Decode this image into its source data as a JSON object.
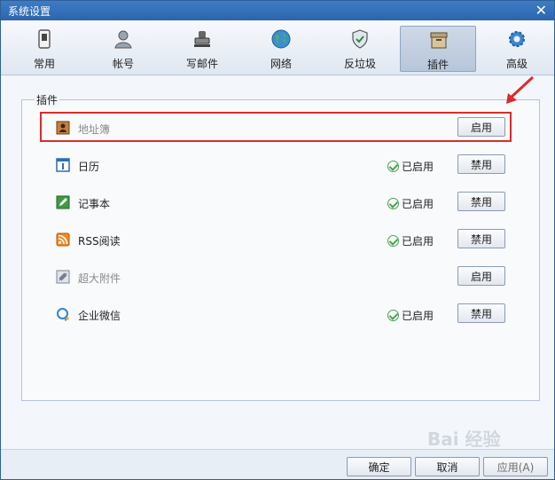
{
  "window": {
    "title": "系统设置",
    "close_glyph": "✕"
  },
  "tabs": [
    {
      "label": "常用",
      "icon": "phone-icon"
    },
    {
      "label": "帐号",
      "icon": "user-icon"
    },
    {
      "label": "写邮件",
      "icon": "stamp-icon"
    },
    {
      "label": "网络",
      "icon": "globe-icon"
    },
    {
      "label": "反垃圾",
      "icon": "shield-icon"
    },
    {
      "label": "插件",
      "icon": "box-icon",
      "active": true
    },
    {
      "label": "高级",
      "icon": "gear-icon"
    }
  ],
  "plugins": {
    "group_label": "插件",
    "rows": [
      {
        "name": "地址簿",
        "enabled": false,
        "status": "",
        "button": "启用"
      },
      {
        "name": "日历",
        "enabled": true,
        "status": "已启用",
        "button": "禁用"
      },
      {
        "name": "记事本",
        "enabled": true,
        "status": "已启用",
        "button": "禁用"
      },
      {
        "name": "RSS阅读",
        "enabled": true,
        "status": "已启用",
        "button": "禁用"
      },
      {
        "name": "超大附件",
        "enabled": false,
        "status": "",
        "button": "启用"
      },
      {
        "name": "企业微信",
        "enabled": true,
        "status": "已启用",
        "button": "禁用"
      }
    ]
  },
  "footer": {
    "ok": "确定",
    "cancel": "取消",
    "apply": "应用(A)"
  },
  "watermark": "Bai 经验",
  "colors": {
    "accent": "#2c65ad",
    "highlight": "#dd2b2b",
    "check": "#4aa34a"
  }
}
